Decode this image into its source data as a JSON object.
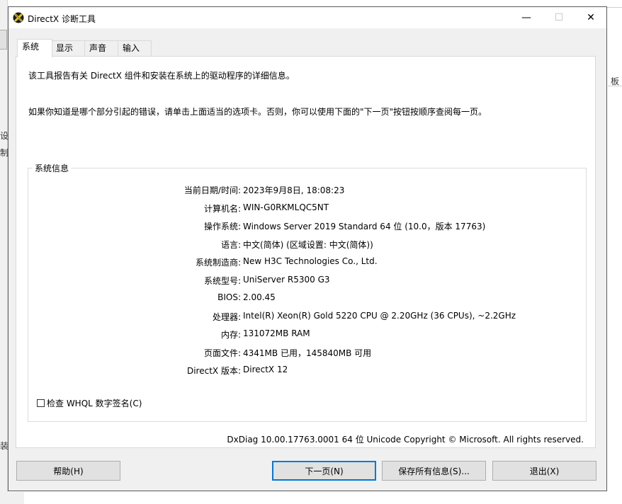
{
  "background": {
    "left_fragments": [
      "设",
      "制",
      "装"
    ],
    "right_fragment": "板"
  },
  "window": {
    "title": "DirectX 诊断工具",
    "controls": {
      "minimize": "—",
      "maximize": "☐",
      "close": "✕"
    }
  },
  "tabs": [
    {
      "label": "系统",
      "active": true
    },
    {
      "label": "显示",
      "active": false
    },
    {
      "label": "声音",
      "active": false
    },
    {
      "label": "输入",
      "active": false
    }
  ],
  "intro": {
    "line1": "该工具报告有关 DirectX 组件和安装在系统上的驱动程序的详细信息。",
    "line2": "如果你知道是哪个部分引起的错误，请单击上面适当的选项卡。否则，你可以使用下面的\"下一页\"按钮按顺序查阅每一页。"
  },
  "system_info": {
    "group_title": "系统信息",
    "rows": [
      {
        "label": "当前日期/时间:",
        "value": "2023年9月8日, 18:08:23"
      },
      {
        "label": "计算机名:",
        "value": "WIN-G0RKMLQC5NT"
      },
      {
        "label": "操作系统:",
        "value": "Windows Server 2019 Standard 64 位 (10.0，版本 17763)"
      },
      {
        "label": "语言:",
        "value": "中文(简体) (区域设置: 中文(简体))"
      },
      {
        "label": "系统制造商:",
        "value": "New H3C Technologies Co., Ltd."
      },
      {
        "label": "系统型号:",
        "value": "UniServer R5300 G3"
      },
      {
        "label": "BIOS:",
        "value": "2.00.45"
      },
      {
        "label": "处理器:",
        "value": "Intel(R) Xeon(R) Gold 5220 CPU @ 2.20GHz (36 CPUs), ~2.2GHz"
      },
      {
        "label": "内存:",
        "value": "131072MB RAM"
      },
      {
        "label": "页面文件:",
        "value": "4341MB 已用，145840MB 可用"
      },
      {
        "label": "DirectX 版本:",
        "value": "DirectX 12"
      }
    ],
    "whql_checkbox": {
      "label": "检查 WHQL 数字签名(C)",
      "checked": false
    }
  },
  "footer_text": "DxDiag 10.00.17763.0001 64 位 Unicode  Copyright © Microsoft. All rights reserved.",
  "buttons": {
    "help": "帮助(H)",
    "next": "下一页(N)",
    "save": "保存所有信息(S)...",
    "exit": "退出(X)"
  },
  "colors": {
    "accent": "#0078d7",
    "dialog_bg": "#f0f0f0",
    "panel_bg": "#ffffff"
  }
}
